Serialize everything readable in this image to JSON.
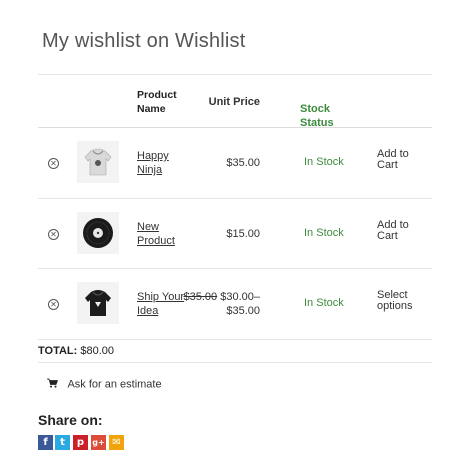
{
  "page_title": "My wishlist on Wishlist",
  "table": {
    "headers": {
      "product_name_line1": "Product",
      "product_name_line2": "Name",
      "unit_price": "Unit Price",
      "stock_line1": "Stock",
      "stock_line2": "Status"
    },
    "rows": [
      {
        "name_line1": "Happy",
        "name_line2": "Ninja",
        "price": "$35.00",
        "stock": "In Stock",
        "action_line1": "Add to",
        "action_line2": "Cart",
        "image_icon": "hoodie-icon"
      },
      {
        "name_line1": "New",
        "name_line2": "Product",
        "price": "$15.00",
        "stock": "In Stock",
        "action_line1": "Add to",
        "action_line2": "Cart",
        "image_icon": "vinyl-record-icon"
      },
      {
        "name_line1": "Ship Your",
        "name_line2": "Idea",
        "price_old": "$35.00",
        "price_range_line1": "$30.00–",
        "price_range_line2": "$35.00",
        "stock": "In Stock",
        "action_line1": "Select",
        "action_line2": "options",
        "image_icon": "black-hoodie-icon"
      }
    ]
  },
  "total": {
    "label": "TOTAL:",
    "value": "$80.00"
  },
  "estimate": {
    "label": "Ask for an estimate",
    "icon": "cart-icon"
  },
  "share": {
    "title": "Share on:",
    "networks": [
      {
        "name": "facebook",
        "glyph": "f",
        "color": "#3b5998"
      },
      {
        "name": "twitter",
        "glyph": "t",
        "color": "#2ba9e1"
      },
      {
        "name": "pinterest",
        "glyph": "p",
        "color": "#cb2027"
      },
      {
        "name": "googleplus",
        "glyph": "g+",
        "color": "#dd4b39"
      },
      {
        "name": "email",
        "glyph": "✉",
        "color": "#f0a30a"
      }
    ]
  }
}
